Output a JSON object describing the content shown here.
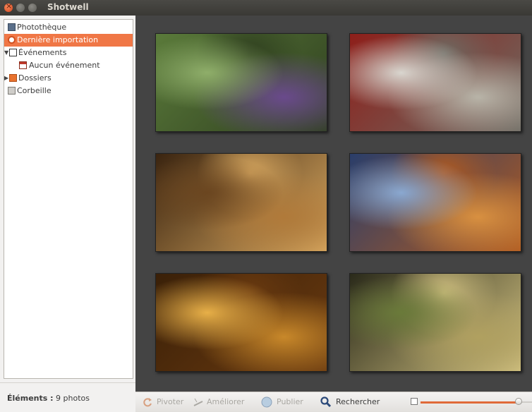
{
  "window": {
    "title": "Shotwell"
  },
  "sidebar": {
    "items": [
      {
        "label": "Photothèque",
        "icon": "library-icon"
      },
      {
        "label": "Dernière importation",
        "icon": "last-import-icon",
        "selected": true
      },
      {
        "label": "Événements",
        "icon": "events-icon",
        "expanded": true
      },
      {
        "label": "Aucun événement",
        "icon": "event-calendar-icon"
      },
      {
        "label": "Dossiers",
        "icon": "folder-icon",
        "expanded": false
      },
      {
        "label": "Corbeille",
        "icon": "trash-icon"
      }
    ]
  },
  "status": {
    "label": "Éléments :",
    "value": "9 photos"
  },
  "photos": [
    {
      "name": "fractal-garden",
      "colors": [
        "#5a7a3a",
        "#6a4a8c",
        "#8fae6a",
        "#2f3f1f"
      ]
    },
    {
      "name": "fractal-spheres",
      "colors": [
        "#8e1f1a",
        "#b8b4a8",
        "#d9d6cf",
        "#6d6a62"
      ]
    },
    {
      "name": "fractal-bronze-waves",
      "colors": [
        "#3a2410",
        "#b07a3a",
        "#6b4620",
        "#d8a860"
      ]
    },
    {
      "name": "fractal-dome",
      "colors": [
        "#2a3e6a",
        "#d89040",
        "#8aa8d0",
        "#b05a20"
      ]
    },
    {
      "name": "fractal-golden-ornament",
      "colors": [
        "#3a2008",
        "#c8882a",
        "#e8b048",
        "#6a3a10"
      ]
    },
    {
      "name": "fractal-forest",
      "colors": [
        "#2a2a1a",
        "#b0a060",
        "#6a7a3a",
        "#d0c080"
      ]
    }
  ],
  "toolbar": {
    "rotate": "Pivoter",
    "enhance": "Améliorer",
    "publish": "Publier",
    "search": "Rechercher",
    "zoom_level": 0.88
  },
  "colors": {
    "selection": "#f07746",
    "canvas": "#444444",
    "accent": "#e06a39"
  }
}
